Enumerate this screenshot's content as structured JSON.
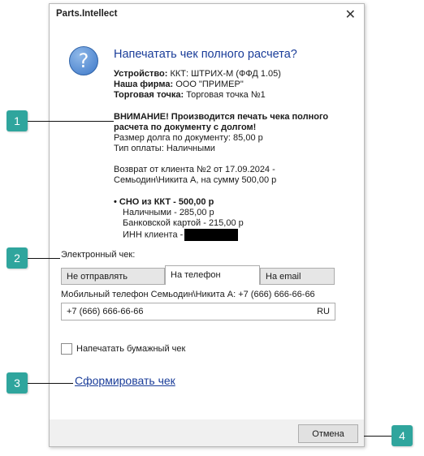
{
  "dialog": {
    "title": "Parts.Intellect",
    "close_glyph": "✕",
    "icon": "question-icon",
    "icon_glyph": "?",
    "heading": "Напечатать чек полного расчета?",
    "device_label": "Устройство:",
    "device_value": "ККТ: ШТРИХ-М (ФФД 1.05)",
    "firm_label": "Наша фирма:",
    "firm_value": "ООО \"ПРИМЕР\"",
    "point_label": "Торговая точка:",
    "point_value": "Торговая точка №1",
    "warning_text": "ВНИМАНИЕ! Производится печать чека полного расчета по документу с долгом!",
    "debt_text": "Размер долга по документу: 85,00 р",
    "payment_type_text": "Тип оплаты: Наличными",
    "return_line1": "Возврат от клиента №2 от 17.09.2024 -",
    "return_line2": "Семьодин\\Никита А, на сумму 500,00 р",
    "sno_text": "• СНО из ККТ - 500,00 р",
    "cash_text": "Наличными - 285,00 р",
    "card_text": "Банковской картой - 215,00 р",
    "inn_text": "ИНН клиента -",
    "e_receipt_label": "Электронный чек:",
    "tabs": [
      {
        "label": "Не отправлять",
        "active": false
      },
      {
        "label": "На телефон",
        "active": true
      },
      {
        "label": "На email",
        "active": false
      }
    ],
    "phone_caption": "Мобильный телефон Семьодин\\Никита А: +7 (666) 666-66-66",
    "phone_value": "+7 (666) 666-66-66",
    "phone_region": "RU",
    "print_paper_label": "Напечатать бумажный чек",
    "print_paper_checked": false,
    "form_link": "Сформировать чек",
    "cancel_label": "Отмена"
  },
  "callouts": [
    "1",
    "2",
    "3",
    "4"
  ],
  "colors": {
    "accent": "#2fa59d",
    "link": "#1a3d99"
  }
}
